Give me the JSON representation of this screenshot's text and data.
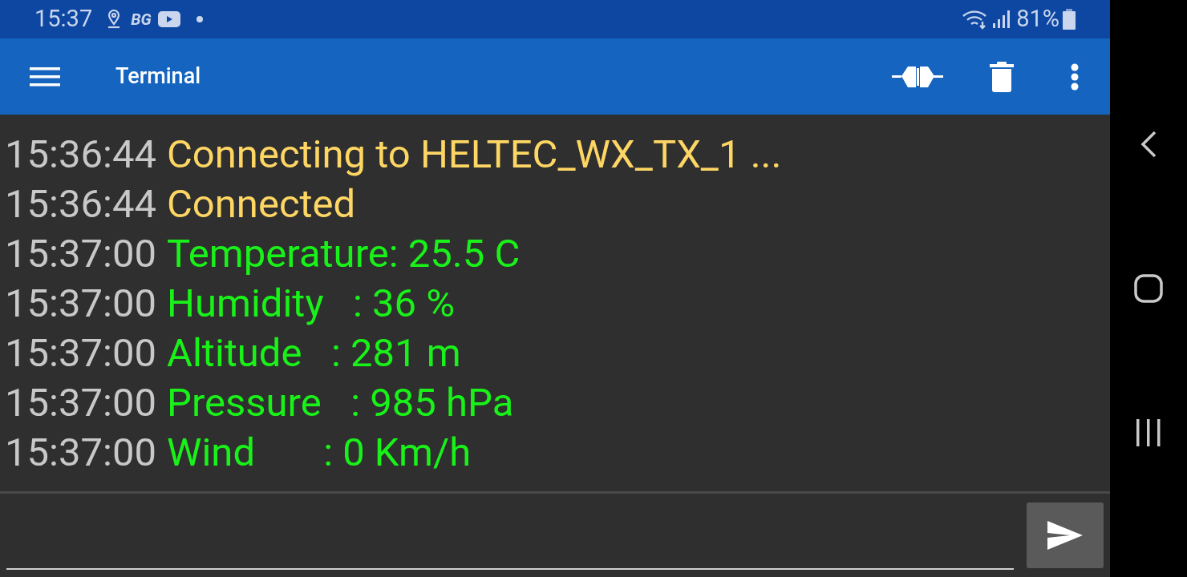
{
  "status_bar": {
    "time": "15:37",
    "carrier_badge": "BG",
    "battery": "81%"
  },
  "app_bar": {
    "title": "Terminal"
  },
  "terminal": {
    "lines": [
      {
        "time": "15:36:44",
        "message": "Connecting to HELTEC_WX_TX_1 ...",
        "color": "#fdd663"
      },
      {
        "time": "15:36:44",
        "message": "Connected",
        "color": "#fdd663"
      },
      {
        "time": "15:37:00",
        "message": "Temperature: 25.5 C",
        "color": "#19f219"
      },
      {
        "time": "15:37:00",
        "message": "Humidity   : 36 %",
        "color": "#19f219"
      },
      {
        "time": "15:37:00",
        "message": "Altitude   : 281 m",
        "color": "#19f219"
      },
      {
        "time": "15:37:00",
        "message": "Pressure   : 985 hPa",
        "color": "#19f219"
      },
      {
        "time": "15:37:00",
        "message": "Wind       : 0 Km/h",
        "color": "#19f219"
      }
    ]
  }
}
